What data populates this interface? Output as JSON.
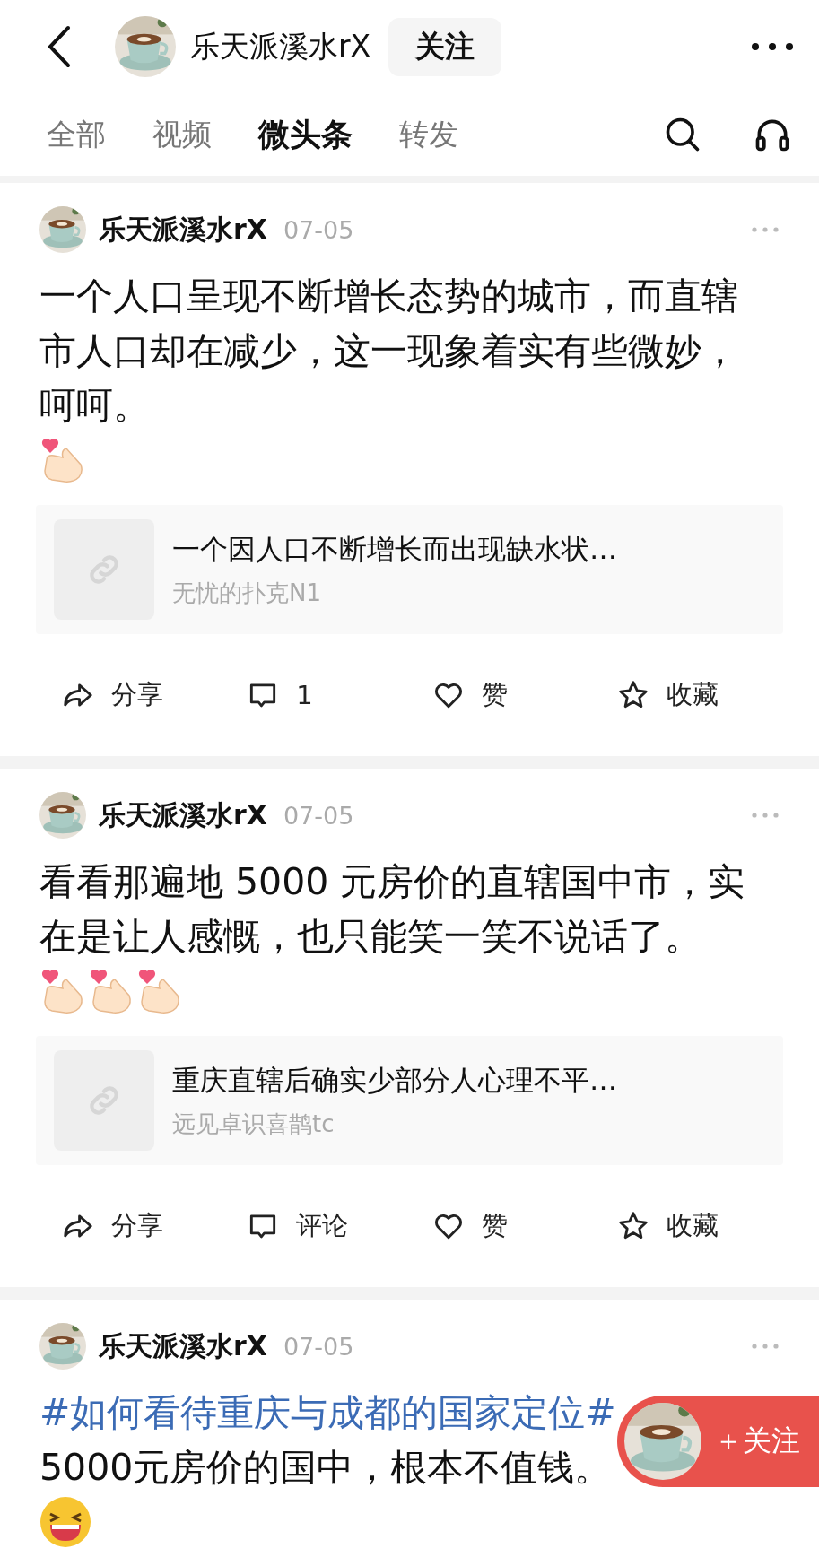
{
  "top_bar": {
    "name": "乐天派溪水rX",
    "follow_label": "关注"
  },
  "tabs": [
    {
      "label": "全部",
      "selected": false
    },
    {
      "label": "视频",
      "selected": false
    },
    {
      "label": "微头条",
      "selected": true
    },
    {
      "label": "转发",
      "selected": false
    }
  ],
  "posts": [
    {
      "author": "乐天派溪水rX",
      "date": "07-05",
      "text": "一个人口呈现不断增长态势的城市，而直辖市人口却在减少，这一现象着实有些微妙，呵呵。",
      "emojis": [
        {
          "kind": "finger_heart"
        }
      ],
      "quote": {
        "title": "一个因人口不断增长而出现缺水状…",
        "author": "无忧的扑克N1"
      },
      "actions": [
        {
          "kind": "share",
          "label": "分享"
        },
        {
          "kind": "comment",
          "label": "1"
        },
        {
          "kind": "like",
          "label": "赞"
        },
        {
          "kind": "favorite",
          "label": "收藏"
        }
      ]
    },
    {
      "author": "乐天派溪水rX",
      "date": "07-05",
      "text": "看看那遍地 5000 元房价的直辖国中市，实在是让人感慨，也只能笑一笑不说话了。",
      "emojis": [
        {
          "kind": "finger_heart"
        },
        {
          "kind": "finger_heart"
        },
        {
          "kind": "finger_heart"
        }
      ],
      "quote": {
        "title": "重庆直辖后确实少部分人心理不平…",
        "author": "远见卓识喜鹊tc"
      },
      "actions": [
        {
          "kind": "share",
          "label": "分享"
        },
        {
          "kind": "comment",
          "label": "评论"
        },
        {
          "kind": "like",
          "label": "赞"
        },
        {
          "kind": "favorite",
          "label": "收藏"
        }
      ]
    },
    {
      "author": "乐天派溪水rX",
      "date": "07-05",
      "hashtag": "#如何看待重庆与成都的国家定位#",
      "text": "5000元房价的国中，根本不值钱。",
      "emojis": [
        {
          "kind": "laughing"
        }
      ]
    }
  ],
  "floating_follow": {
    "label": "＋关注"
  }
}
